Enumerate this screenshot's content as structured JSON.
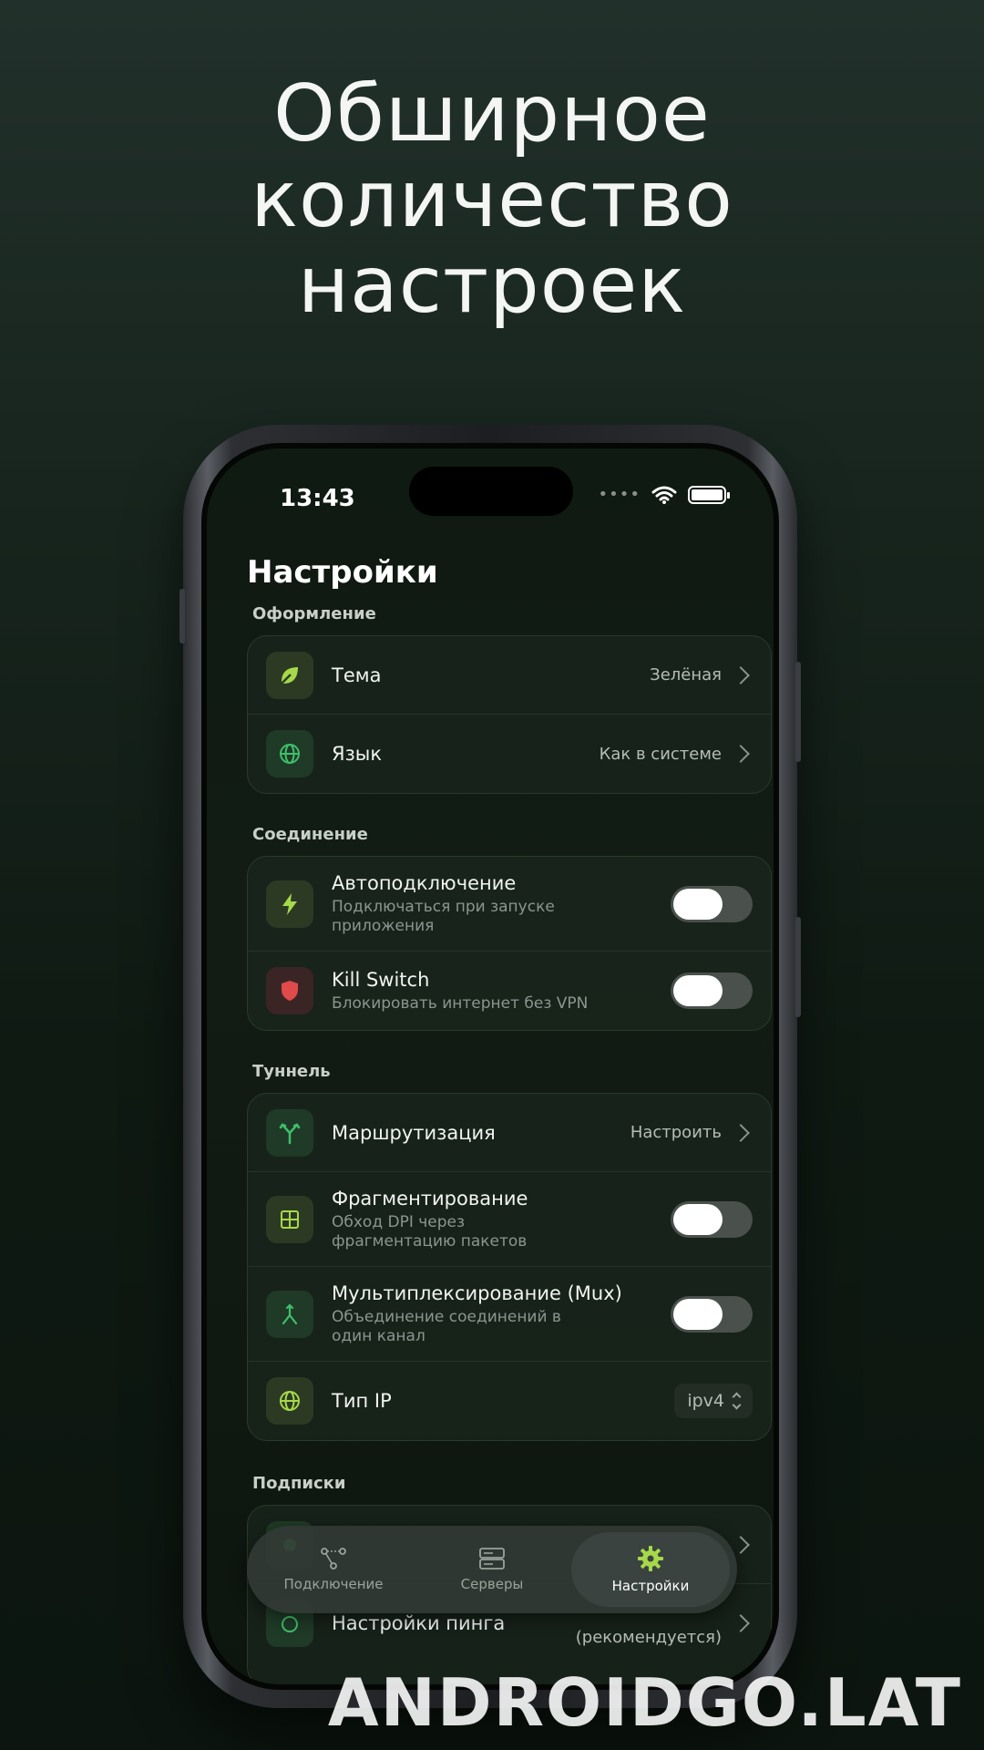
{
  "headline": [
    "Обширное",
    "количество",
    "настроек"
  ],
  "status": {
    "time": "13:43"
  },
  "page": {
    "title": "Настройки"
  },
  "sections": {
    "appearance": {
      "label": "Оформление",
      "theme": {
        "title": "Тема",
        "value": "Зелёная",
        "icon": "leaf-icon"
      },
      "language": {
        "title": "Язык",
        "value": "Как в системе",
        "icon": "globe-icon"
      }
    },
    "connection": {
      "label": "Соединение",
      "autoconnect": {
        "title": "Автоподключение",
        "subtitle": "Подключаться при запуске приложения",
        "enabled": false,
        "icon": "bolt-icon"
      },
      "killswitch": {
        "title": "Kill Switch",
        "subtitle": "Блокировать интернет без VPN",
        "enabled": false,
        "icon": "shield-icon"
      }
    },
    "tunnel": {
      "label": "Туннель",
      "routing": {
        "title": "Маршрутизация",
        "value": "Настроить",
        "icon": "fork-icon"
      },
      "fragmentation": {
        "title": "Фрагментирование",
        "subtitle": "Обход DPI через фрагментацию пакетов",
        "enabled": false,
        "icon": "grid-icon"
      },
      "mux": {
        "title": "Мультиплексирование (Mux)",
        "subtitle": "Объединение соединений в один канал",
        "enabled": false,
        "icon": "merge-icon"
      },
      "ip_type": {
        "title": "Тип IP",
        "value": "ipv4",
        "icon": "globe-icon"
      }
    },
    "subscriptions": {
      "label": "Подписки",
      "ping": {
        "title": "Настройки пинга",
        "value": "(рекомендуется)"
      }
    }
  },
  "tabbar": {
    "tabs": [
      {
        "label": "Подключение",
        "icon": "nodes-icon"
      },
      {
        "label": "Серверы",
        "icon": "server-icon"
      },
      {
        "label": "Настройки",
        "icon": "gear-icon",
        "active": true
      }
    ]
  },
  "watermark": "ANDROIDGO.LAT",
  "colors": {
    "accent": "#a6d94a",
    "green_icon": "#3fbf6a",
    "danger": "#e04a4a"
  }
}
